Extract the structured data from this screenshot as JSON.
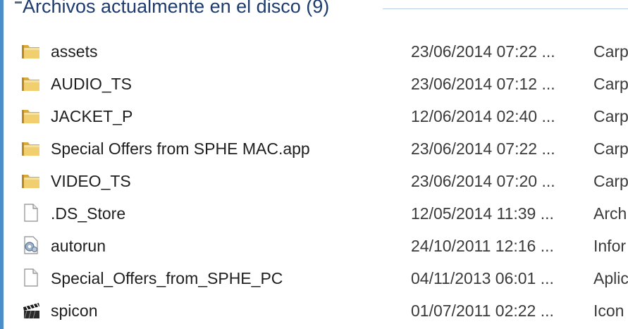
{
  "group": {
    "title": "Archivos actualmente en el disco (9)"
  },
  "files": [
    {
      "name": "assets",
      "date": "23/06/2014 07:22 ...",
      "type": "Carp",
      "icon": "folder-icon"
    },
    {
      "name": "AUDIO_TS",
      "date": "23/06/2014 07:12 ...",
      "type": "Carp",
      "icon": "folder-icon"
    },
    {
      "name": "JACKET_P",
      "date": "12/06/2014 02:40 ...",
      "type": "Carp",
      "icon": "folder-icon"
    },
    {
      "name": "Special Offers from SPHE MAC.app",
      "date": "23/06/2014 07:22 ...",
      "type": "Carp",
      "icon": "folder-icon"
    },
    {
      "name": "VIDEO_TS",
      "date": "23/06/2014 07:20 ...",
      "type": "Carp",
      "icon": "folder-icon"
    },
    {
      "name": ".DS_Store",
      "date": "12/05/2014 11:39 ...",
      "type": "Arch",
      "icon": "blank-file-icon"
    },
    {
      "name": "autorun",
      "date": "24/10/2011 12:16 ...",
      "type": "Infor",
      "icon": "settings-file-icon"
    },
    {
      "name": "Special_Offers_from_SPHE_PC",
      "date": "04/11/2013 06:01 ...",
      "type": "Aplic",
      "icon": "blank-file-icon"
    },
    {
      "name": "spicon",
      "date": "01/07/2011 02:22 ...",
      "type": "Icon",
      "icon": "clapperboard-icon"
    }
  ],
  "colors": {
    "accent": "#4a8fc9",
    "folder": "#e8c25a",
    "title": "#1d3b6e"
  }
}
